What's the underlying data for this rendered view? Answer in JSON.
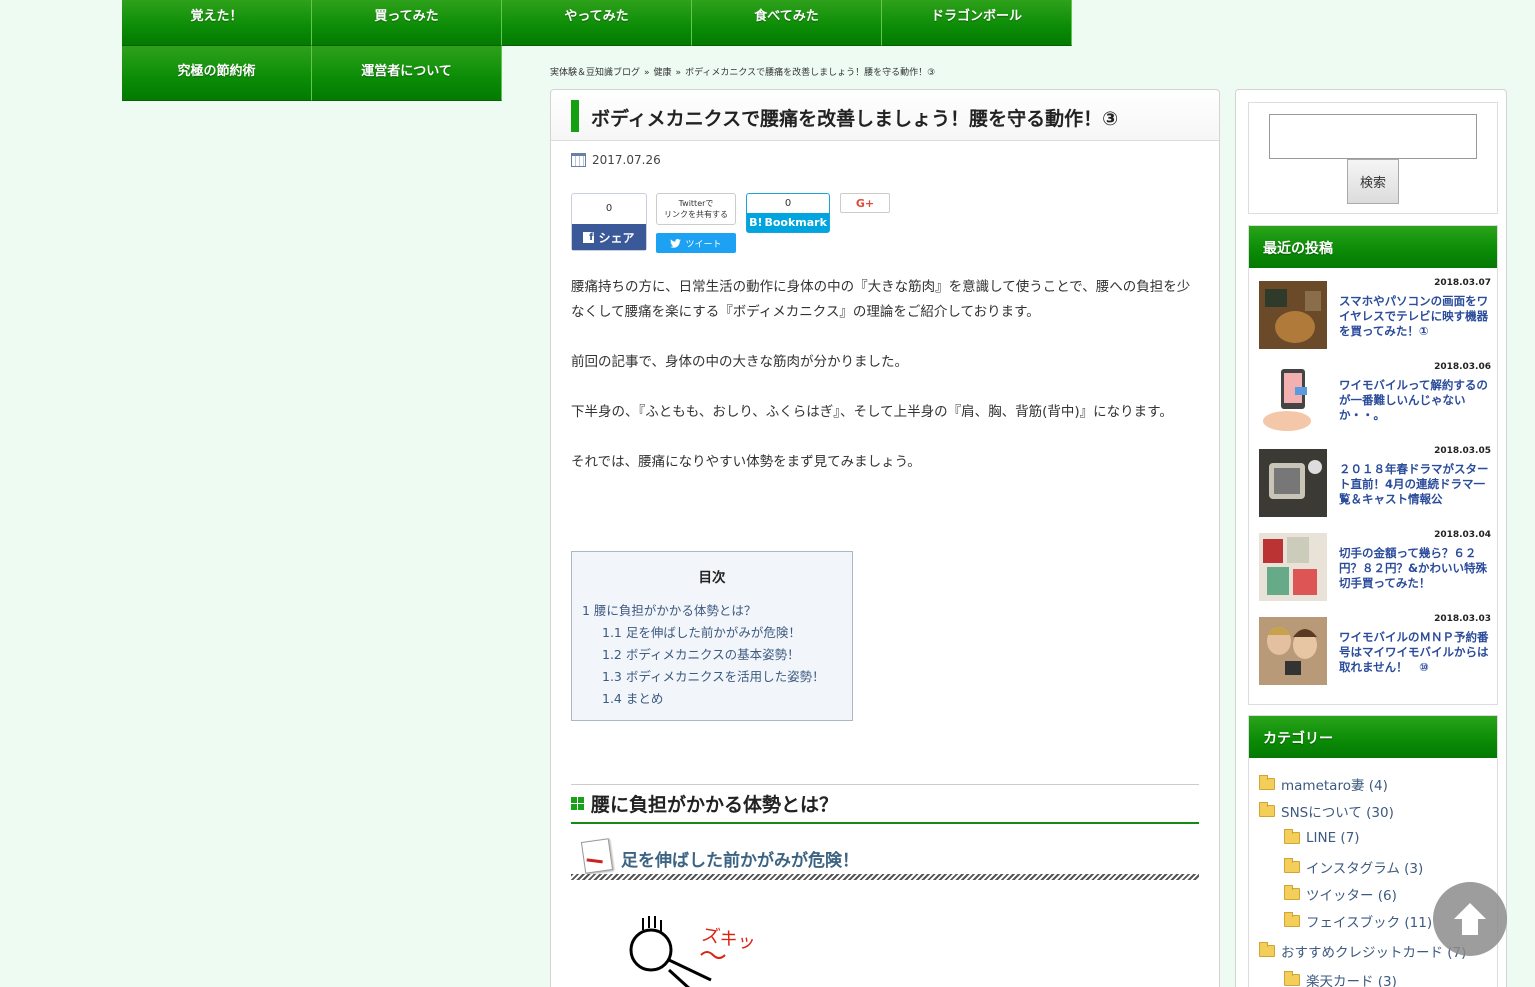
{
  "nav": {
    "row1": [
      "覚えた！",
      "買ってみた",
      "やってみた",
      "食べてみた",
      "ドラゴンボール"
    ],
    "row2": [
      "究極の節約術",
      "運営者について"
    ]
  },
  "breadcrumb": [
    "実体験＆豆知識ブログ",
    "健康",
    "ボディメカニクスで腰痛を改善しましょう！腰を守る動作！③"
  ],
  "article": {
    "title": "ボディメカニクスで腰痛を改善しましょう！腰を守る動作！③",
    "date": "2017.07.26",
    "share": {
      "fb_count": "0",
      "fb_label": "シェア",
      "tw_line1": "Twitterで",
      "tw_line2": "リンクを共有する",
      "tw_button": "ツイート",
      "hb_count": "0",
      "hb_label": "Bookmark",
      "gplus": "G+"
    },
    "paragraphs": [
      "腰痛持ちの方に、日常生活の動作に身体の中の『大きな筋肉』を意識して使うことで、腰への負担を少なくして腰痛を楽にする『ボディメカニクス』の理論をご紹介しております。",
      "前回の記事で、身体の中の大きな筋肉が分かりました。",
      "下半身の、『ふともも、おしり、ふくらはぎ』、そして上半身の『肩、胸、背筋(背中)』になります。",
      "それでは、腰痛になりやすい体勢をまず見てみましょう。"
    ],
    "toc": {
      "title": "目次",
      "items": [
        {
          "label": "1 腰に負担がかかる体勢とは？",
          "level": 1
        },
        {
          "label": "1.1 足を伸ばした前かがみが危険！",
          "level": 2
        },
        {
          "label": "1.2 ボディメカニクスの基本姿勢！",
          "level": 2
        },
        {
          "label": "1.3 ボディメカニクスを活用した姿勢！",
          "level": 2
        },
        {
          "label": "1.4 まとめ",
          "level": 2
        }
      ]
    },
    "h2": "腰に負担がかかる体勢とは？",
    "h3": "足を伸ばした前かがみが危険！",
    "illustration_text": "ズキッ"
  },
  "sidebar": {
    "search_button": "検索",
    "recent_title": "最近の投稿",
    "posts": [
      {
        "date": "2018.03.07",
        "title": "スマホやパソコンの画面をワイヤレスでテレビに映す機器を買ってみた！①"
      },
      {
        "date": "2018.03.06",
        "title": "ワイモバイルって解約するのが一番難しいんじゃないか・・。"
      },
      {
        "date": "2018.03.05",
        "title": "２０１８年春ドラマがスタート直前！4月の連続ドラマ一覧＆キャスト情報公"
      },
      {
        "date": "2018.03.04",
        "title": "切手の金額って幾ら？６２円？８２円？&かわいい特殊切手買ってみた！"
      },
      {
        "date": "2018.03.03",
        "title": "ワイモバイルのＭＮＰ予約番号はマイワイモバイルからは取れません！　⑩"
      }
    ],
    "cat_title": "カテゴリー",
    "categories": [
      {
        "label": "mametaro妻 (4)",
        "level": 1
      },
      {
        "label": "SNSについて (30)",
        "level": 1
      },
      {
        "label": "LINE (7)",
        "level": 2
      },
      {
        "label": "インスタグラム (3)",
        "level": 2
      },
      {
        "label": "ツイッター (6)",
        "level": 2
      },
      {
        "label": "フェイスブック (11)",
        "level": 2
      },
      {
        "label": "おすすめクレジットカード (7)",
        "level": 1
      },
      {
        "label": "楽天カード (3)",
        "level": 2
      }
    ]
  },
  "colors": {
    "nav_green": "#0b8c06",
    "background": "#eefbf3",
    "link_blue": "#2b4c9b"
  }
}
